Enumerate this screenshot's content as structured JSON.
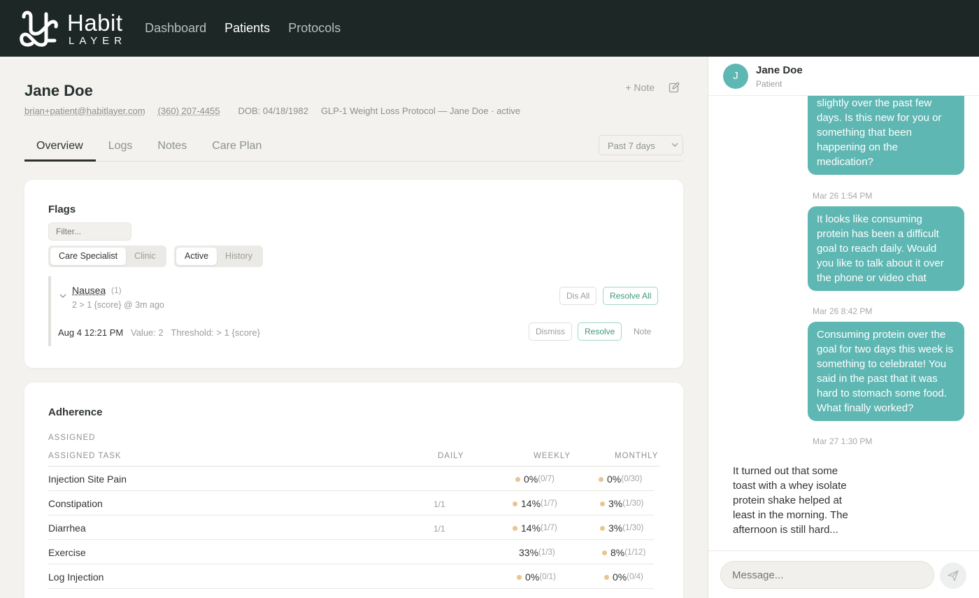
{
  "app": {
    "logo_word": "Habit",
    "logo_sub": "LAYER",
    "nav": [
      {
        "label": "Dashboard",
        "active": false
      },
      {
        "label": "Patients",
        "active": true
      },
      {
        "label": "Protocols",
        "active": false
      }
    ]
  },
  "patient": {
    "name": "Jane Doe",
    "email": "brian+patient@habitlayer.com",
    "phone": "(360) 207-4455",
    "dob": "DOB: 04/18/1982",
    "protocol": "GLP-1 Weight Loss Protocol — Jane Doe · active",
    "note_button": "+ Note",
    "edit_icon": "edit-icon"
  },
  "tabs": [
    {
      "label": "Overview",
      "active": true
    },
    {
      "label": "Logs",
      "active": false
    },
    {
      "label": "Notes",
      "active": false
    },
    {
      "label": "Care Plan",
      "active": false
    }
  ],
  "range_select": {
    "value": "Past 7 days"
  },
  "flags": {
    "title": "Flags",
    "filter_placeholder": "Filter...",
    "segment_a": [
      {
        "label": "Care Specialist",
        "on": true
      },
      {
        "label": "Clinic",
        "on": false
      }
    ],
    "segment_b": [
      {
        "label": "Active",
        "on": true
      },
      {
        "label": "History",
        "on": false
      }
    ],
    "group": {
      "name": "Nausea",
      "count": "(1)",
      "summary": "2 > 1 {score} @ 3m ago",
      "dismiss_all": "Dis All",
      "resolve_all": "Resolve All",
      "entry": {
        "date": "Aug 4 12:21 PM",
        "value": "Value: 2",
        "threshold": "Threshold: > 1 {score}",
        "dismiss": "Dismiss",
        "resolve": "Resolve",
        "note": "Note"
      }
    }
  },
  "adherence": {
    "title": "Adherence",
    "section": "ASSIGNED",
    "columns": {
      "task": "ASSIGNED TASK",
      "daily": "DAILY",
      "weekly": "WEEKLY",
      "monthly": "MONTHLY"
    },
    "rows": [
      {
        "task": "Injection Site Pain",
        "daily": "",
        "weekly": "0%",
        "weekly_frac": "(0/7)",
        "monthly": "0%",
        "monthly_frac": "(0/30)"
      },
      {
        "task": "Constipation",
        "daily": "1/1",
        "weekly": "14%",
        "weekly_frac": "(1/7)",
        "monthly": "3%",
        "monthly_frac": "(1/30)"
      },
      {
        "task": "Diarrhea",
        "daily": "1/1",
        "weekly": "14%",
        "weekly_frac": "(1/7)",
        "monthly": "3%",
        "monthly_frac": "(1/30)"
      },
      {
        "task": "Exercise",
        "daily": "",
        "weekly": "33%",
        "weekly_frac": "(1/3)",
        "monthly": "8%",
        "monthly_frac": "(1/12)"
      },
      {
        "task": "Log Injection",
        "daily": "",
        "weekly": "0%",
        "weekly_frac": "(0/1)",
        "monthly": "0%",
        "monthly_frac": "(0/4)"
      }
    ]
  },
  "chat": {
    "avatar_initial": "J",
    "name": "Jane Doe",
    "role": "Patient",
    "messages": [
      {
        "text": "slightly over the past few days. Is this new for you or something that been happening on the medication?"
      },
      {
        "time": "Mar 26 1:54 PM",
        "text": "It looks like consuming protein has been a difficult goal to reach daily. Would you like to talk about it over the phone or video chat"
      },
      {
        "time": "Mar 26 8:42 PM",
        "text": "Consuming protein over the goal for two days this week is something to celebrate! You said in the past that it was hard to stomach some food. What finally worked?"
      },
      {
        "time": "Mar 27 1:30 PM",
        "text": "It turned out that some toast with a whey isolate protein shake helped at least in the morning. The afternoon is still hard..."
      }
    ],
    "input_placeholder": "Message...",
    "send_icon": "send-icon"
  },
  "colors": {
    "topbar": "#1d2826",
    "accent": "#5fb7b3",
    "resolve_green": "#3e9a76",
    "dot": "#e9c58f",
    "background": "#f3f2ee"
  }
}
